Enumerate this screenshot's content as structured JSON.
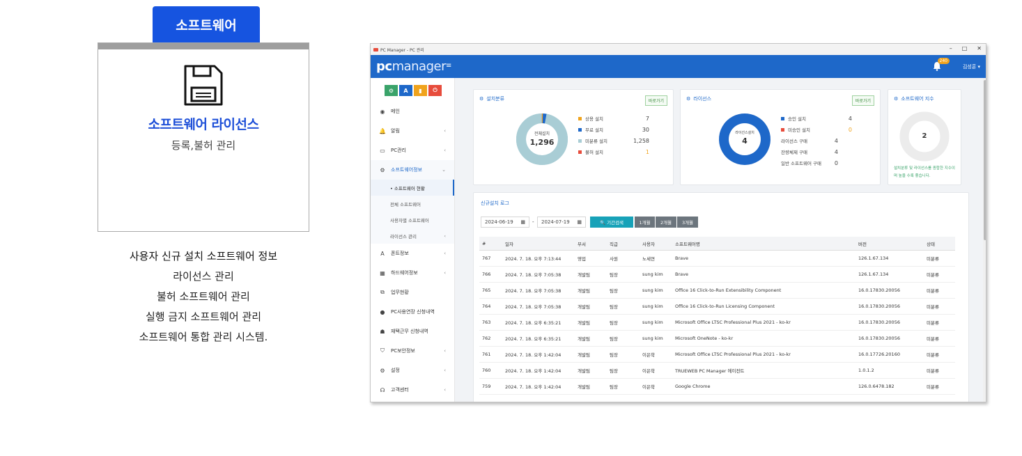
{
  "promo": {
    "tab_label": "소프트웨어",
    "card_title": "소프트웨어 라이선스",
    "card_subtitle": "등록,불허 관리",
    "description": [
      "사용자 신규 설치 소프트웨어 정보",
      "라이선스 관리",
      "불허 소프트웨어 관리",
      "실행 금지 소프트웨어 관리",
      "소프트웨어 통합  관리 시스템."
    ]
  },
  "window": {
    "title": "PC Manager - PC 관리",
    "controls": {
      "minimize": "–",
      "maximize": "□",
      "close": "✕"
    }
  },
  "header": {
    "logo_pc": "pc",
    "logo_manager": "manager",
    "menu_icon": "≡",
    "notification_count": "240",
    "user_name": "김성훈 ▾"
  },
  "colors": {
    "brand": "#1e68c9",
    "promo_blue": "#1654e0",
    "donut_used": "#1e68c9",
    "donut_track": "#b5d6dd",
    "green": "#3aa36a"
  },
  "sidebar": {
    "quick_buttons": [
      {
        "label": "⚙",
        "color": "#3aa36a"
      },
      {
        "label": "A",
        "color": "#1e68c9"
      },
      {
        "label": "▮",
        "color": "#f0a31c"
      },
      {
        "label": "⏻",
        "color": "#e74c3c"
      }
    ],
    "items": [
      {
        "icon": "◉",
        "label": "메인",
        "chev": ""
      },
      {
        "icon": "🔔",
        "label": "알림",
        "chev": "‹"
      },
      {
        "icon": "▭",
        "label": "PC관리",
        "chev": "‹"
      },
      {
        "icon": "⚙",
        "label": "소프트웨어정보",
        "chev": "⌄"
      }
    ],
    "subitems": [
      {
        "label": "• 소프트웨어 현황",
        "chev": ""
      },
      {
        "label": "전체 소프트웨어",
        "chev": ""
      },
      {
        "label": "사용자별 소프트웨어",
        "chev": ""
      },
      {
        "label": "라이선스 관리",
        "chev": "‹"
      }
    ],
    "items_after": [
      {
        "icon": "A",
        "label": "폰트정보",
        "chev": "‹"
      },
      {
        "icon": "▦",
        "label": "하드웨어정보",
        "chev": "‹"
      },
      {
        "icon": "⧉",
        "label": "업무현황",
        "chev": ""
      },
      {
        "icon": "●",
        "label": "PC사용연장 신청내역",
        "chev": ""
      },
      {
        "icon": "☗",
        "label": "재택근무 신청내역",
        "chev": ""
      },
      {
        "icon": "⛉",
        "label": "PC보안정보",
        "chev": "‹"
      },
      {
        "icon": "⚙",
        "label": "설정",
        "chev": "‹"
      },
      {
        "icon": "☊",
        "label": "고객센터",
        "chev": "‹"
      }
    ]
  },
  "install_card": {
    "title": "설치분류",
    "goto": "바로가기",
    "center_label": "전체설치",
    "center_value": "1,296",
    "legend": [
      {
        "label": "상용 설치",
        "value": "7",
        "color": "#f0a31c",
        "value_color": "#444"
      },
      {
        "label": "무료 설치",
        "value": "30",
        "color": "#1e68c9",
        "value_color": "#444"
      },
      {
        "label": "미분류 설치",
        "value": "1,258",
        "color": "#a9cdd5",
        "value_color": "#444"
      },
      {
        "label": "불허 설치",
        "value": "1",
        "color": "#e74c3c",
        "value_color": "#f0a31c"
      }
    ],
    "donut": [
      7,
      30,
      1258,
      1
    ]
  },
  "license_card": {
    "title": "라이선스",
    "goto": "바로가기",
    "center_label": "라이선스설치",
    "center_value": "4",
    "legend": [
      {
        "label": "승인 설치",
        "value": "4",
        "color": "#1e68c9",
        "value_color": "#444"
      },
      {
        "label": "미승인 설치",
        "value": "0",
        "color": "#e74c3c",
        "value_color": "#f0a31c"
      }
    ],
    "stats": [
      {
        "label": "라이선스 구매",
        "value": "4"
      },
      {
        "label": "잔량체제 구매",
        "value": "4"
      },
      {
        "label": "일반 소프트웨어 구매",
        "value": "0"
      }
    ],
    "donut": [
      4,
      0
    ]
  },
  "index_card": {
    "title": "소프트웨어 지수",
    "center_value": "2",
    "note": "설치분류 및 라이선스를 종합한 지수이며 높을 수록 좋습니다."
  },
  "log": {
    "title": "신규설치 로그",
    "date_from": "2024-06-19",
    "date_to": "2024-07-19",
    "date_sep": "-",
    "search_label": "🔍 기간검색",
    "range_buttons": [
      "1개월",
      "2개월",
      "3개월"
    ],
    "columns": [
      "#",
      "일자",
      "부서",
      "직급",
      "사용자",
      "소프트웨어명",
      "버전",
      "상태"
    ],
    "rows": [
      [
        "767",
        "2024. 7. 18. 오후 7:13:44",
        "영업",
        "사원",
        "노세연",
        "Brave",
        "126.1.67.134",
        "미분류"
      ],
      [
        "766",
        "2024. 7. 18. 오후 7:05:38",
        "개발팀",
        "팀장",
        "sung kim",
        "Brave",
        "126.1.67.134",
        "미분류"
      ],
      [
        "765",
        "2024. 7. 18. 오후 7:05:38",
        "개발팀",
        "팀장",
        "sung kim",
        "Office 16 Click-to-Run Extensibility Component",
        "16.0.17830.20056",
        "미분류"
      ],
      [
        "764",
        "2024. 7. 18. 오후 7:05:38",
        "개발팀",
        "팀장",
        "sung kim",
        "Office 16 Click-to-Run Licensing Component",
        "16.0.17830.20056",
        "미분류"
      ],
      [
        "763",
        "2024. 7. 18. 오후 6:35:21",
        "개발팀",
        "팀장",
        "sung kim",
        "Microsoft Office LTSC Professional Plus 2021 - ko-kr",
        "16.0.17830.20056",
        "미분류"
      ],
      [
        "762",
        "2024. 7. 18. 오후 6:35:21",
        "개발팀",
        "팀장",
        "sung kim",
        "Microsoft OneNote - ko-kr",
        "16.0.17830.20056",
        "미분류"
      ],
      [
        "761",
        "2024. 7. 18. 오후 1:42:04",
        "개발팀",
        "팀장",
        "이은학",
        "Microsoft Office LTSC Professional Plus 2021 - ko-kr",
        "16.0.17726.20160",
        "미분류"
      ],
      [
        "760",
        "2024. 7. 18. 오후 1:42:04",
        "개발팀",
        "팀장",
        "이은학",
        "TRUEWEB PC Manager 에이전트",
        "1.0.1.2",
        "미분류"
      ],
      [
        "759",
        "2024. 7. 18. 오후 1:42:04",
        "개발팀",
        "팀장",
        "이은학",
        "Google Chrome",
        "126.0.6478.182",
        "미분류"
      ]
    ]
  }
}
